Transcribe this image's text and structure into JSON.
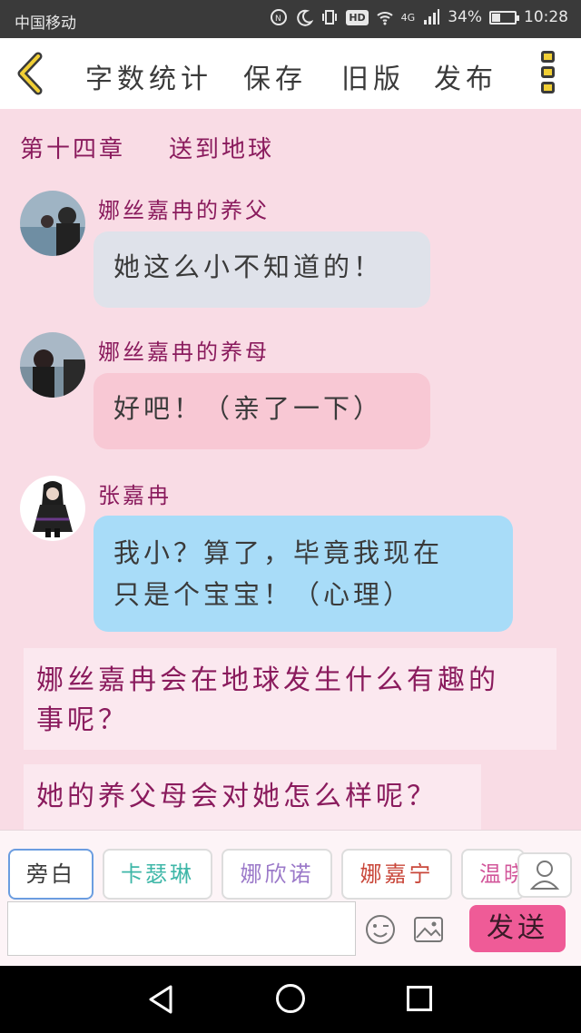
{
  "status_bar": {
    "carrier": "中国移动",
    "network": "4G",
    "hd": "HD",
    "battery_percent": "34%",
    "battery_level": 0.34,
    "time": "10:28"
  },
  "toolbar": {
    "word_count_label": "字数统计",
    "save_label": "保存",
    "old_version_label": "旧版",
    "publish_label": "发布"
  },
  "chapter": {
    "number": "第十四章",
    "title": "送到地球"
  },
  "messages": [
    {
      "speaker": "娜丝嘉冉的养父",
      "text": "她这么小不知道的！",
      "bubble_color": "#dfe2ea"
    },
    {
      "speaker": "娜丝嘉冉的养母",
      "text": "好吧！（亲了一下）",
      "bubble_color": "#f8c8d4"
    },
    {
      "speaker": "张嘉冉",
      "line1": "我小？算了，毕竟我现在",
      "line2": "只是个宝宝！（心理）",
      "bubble_color": "#a8dcf8"
    }
  ],
  "narration": [
    {
      "line1": "娜丝嘉冉会在地球发生什么有趣的",
      "line2": "事呢？"
    },
    {
      "text": "她的养父母会对她怎么样呢？"
    }
  ],
  "characters": [
    {
      "label": "旁白",
      "color": "#3a3a3a"
    },
    {
      "label": "卡瑟琳",
      "color": "#3fb7a8"
    },
    {
      "label": "娜欣诺",
      "color": "#9b79c9"
    },
    {
      "label": "娜嘉宁",
      "color": "#c9473a"
    },
    {
      "label": "温晓",
      "color": "#d2569a"
    }
  ],
  "input": {
    "value": "",
    "placeholder": ""
  },
  "send_label": "发送",
  "colors": {
    "background": "#f9dce5",
    "accent_pink": "#ef5b97",
    "name_color": "#8a1b5d",
    "back_arrow": "#f1cf35"
  }
}
